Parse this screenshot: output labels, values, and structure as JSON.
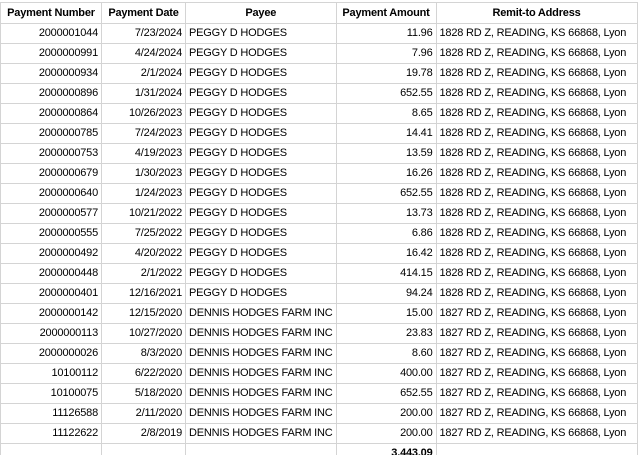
{
  "columns": [
    "Payment Number",
    "Payment Date",
    "Payee",
    "Payment Amount",
    "Remit-to Address"
  ],
  "rows": [
    [
      "2000001044",
      "7/23/2024",
      "PEGGY D HODGES",
      "11.96",
      "1828 RD Z, READING, KS 66868, Lyon"
    ],
    [
      "2000000991",
      "4/24/2024",
      "PEGGY D HODGES",
      "7.96",
      "1828 RD Z, READING, KS 66868, Lyon"
    ],
    [
      "2000000934",
      "2/1/2024",
      "PEGGY D HODGES",
      "19.78",
      "1828 RD Z, READING, KS 66868, Lyon"
    ],
    [
      "2000000896",
      "1/31/2024",
      "PEGGY D HODGES",
      "652.55",
      "1828 RD Z, READING, KS 66868, Lyon"
    ],
    [
      "2000000864",
      "10/26/2023",
      "PEGGY D HODGES",
      "8.65",
      "1828 RD Z, READING, KS 66868, Lyon"
    ],
    [
      "2000000785",
      "7/24/2023",
      "PEGGY D HODGES",
      "14.41",
      "1828 RD Z, READING, KS 66868, Lyon"
    ],
    [
      "2000000753",
      "4/19/2023",
      "PEGGY D HODGES",
      "13.59",
      "1828 RD Z, READING, KS 66868, Lyon"
    ],
    [
      "2000000679",
      "1/30/2023",
      "PEGGY D HODGES",
      "16.26",
      "1828 RD Z, READING, KS 66868, Lyon"
    ],
    [
      "2000000640",
      "1/24/2023",
      "PEGGY D HODGES",
      "652.55",
      "1828 RD Z, READING, KS 66868, Lyon"
    ],
    [
      "2000000577",
      "10/21/2022",
      "PEGGY D HODGES",
      "13.73",
      "1828 RD Z, READING, KS 66868, Lyon"
    ],
    [
      "2000000555",
      "7/25/2022",
      "PEGGY D HODGES",
      "6.86",
      "1828 RD Z, READING, KS 66868, Lyon"
    ],
    [
      "2000000492",
      "4/20/2022",
      "PEGGY D HODGES",
      "16.42",
      "1828 RD Z, READING, KS 66868, Lyon"
    ],
    [
      "2000000448",
      "2/1/2022",
      "PEGGY D HODGES",
      "414.15",
      "1828 RD Z, READING, KS 66868, Lyon"
    ],
    [
      "2000000401",
      "12/16/2021",
      "PEGGY D HODGES",
      "94.24",
      "1828 RD Z, READING, KS 66868, Lyon"
    ],
    [
      "2000000142",
      "12/15/2020",
      "DENNIS HODGES FARM INC",
      "15.00",
      "1827 RD Z, READING, KS 66868, Lyon"
    ],
    [
      "2000000113",
      "10/27/2020",
      "DENNIS HODGES FARM INC",
      "23.83",
      "1827 RD Z, READING, KS 66868, Lyon"
    ],
    [
      "2000000026",
      "8/3/2020",
      "DENNIS HODGES FARM INC",
      "8.60",
      "1827 RD Z, READING, KS 66868, Lyon"
    ],
    [
      "10100112",
      "6/22/2020",
      "DENNIS HODGES FARM INC",
      "400.00",
      "1827 RD Z, READING, KS 66868, Lyon"
    ],
    [
      "10100075",
      "5/18/2020",
      "DENNIS HODGES FARM INC",
      "652.55",
      "1827 RD Z, READING, KS 66868, Lyon"
    ],
    [
      "11126588",
      "2/11/2020",
      "DENNIS HODGES FARM INC",
      "200.00",
      "1827 RD Z, READING, KS 66868, Lyon"
    ],
    [
      "11122622",
      "2/8/2019",
      "DENNIS HODGES FARM INC",
      "200.00",
      "1827 RD Z, READING, KS 66868, Lyon"
    ]
  ],
  "total": "3,443.09"
}
